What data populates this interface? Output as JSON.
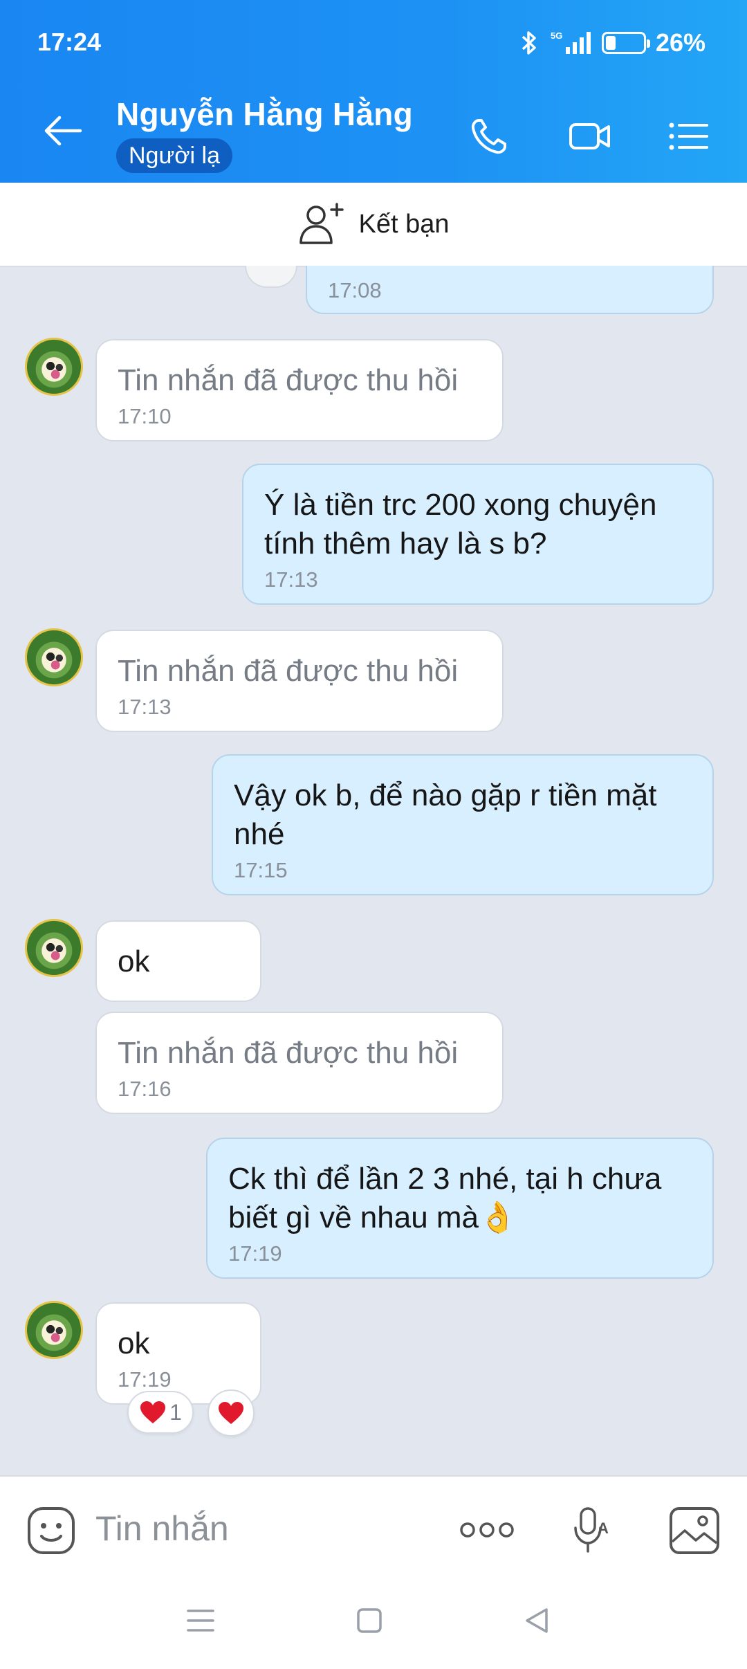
{
  "status_bar": {
    "time": "17:24",
    "network": "5G",
    "battery": "26%",
    "battery_level": 0.26
  },
  "header": {
    "contact_name": "Nguyễn Hằng Hằng",
    "badge": "Người lạ",
    "icons": [
      "back-arrow-icon",
      "phone-icon",
      "video-call-icon",
      "menu-list-icon"
    ]
  },
  "add_friend": {
    "label": "Kết bạn",
    "icon": "add-user-icon"
  },
  "messages": [
    {
      "from": "me",
      "text": "",
      "time": "17:08"
    },
    {
      "from": "them",
      "text": "Tin nhắn đã được thu hồi",
      "time": "17:10",
      "recalled": true
    },
    {
      "from": "me",
      "text": "Ý là tiền trc 200 xong chuyện tính thêm hay là s b?",
      "line1": "Ý là tiền trc 200 xong chuyện",
      "line2": "tính thêm hay là s b?",
      "time": "17:13"
    },
    {
      "from": "them",
      "text": "Tin nhắn đã được thu hồi",
      "time": "17:13",
      "recalled": true
    },
    {
      "from": "me",
      "text": "Vậy ok b, để nào gặp r tiền mặt nhé",
      "line1": "Vậy ok b, để nào gặp r tiền mặt",
      "line2": "nhé",
      "time": "17:15"
    },
    {
      "from": "them",
      "text": "ok",
      "time": ""
    },
    {
      "from": "them",
      "text": "Tin nhắn đã được thu hồi",
      "time": "17:16",
      "recalled": true
    },
    {
      "from": "me",
      "text": "Ck thì để lần 2 3 nhé, tại h chưa biết gì về nhau mà👌",
      "line1": "Ck thì để lần 2 3 nhé, tại h chưa",
      "line2": "biết gì về nhau mà👌",
      "time": "17:19"
    },
    {
      "from": "them",
      "text": "ok",
      "time": "17:19",
      "reactions": {
        "emoji": "❤️",
        "count": "1"
      }
    }
  ],
  "input_bar": {
    "placeholder": "Tin nhắn",
    "icons": [
      "sticker-icon",
      "more-dots-icon",
      "voice-to-text-icon",
      "image-icon"
    ]
  },
  "colors": {
    "header_blue": "#1a86f2",
    "outgoing_bubble": "#d7efff",
    "incoming_bubble": "#ffffff",
    "chat_bg": "#e2e7ef",
    "badge_bg": "#0f5fc2",
    "heart": "#e0192d"
  }
}
